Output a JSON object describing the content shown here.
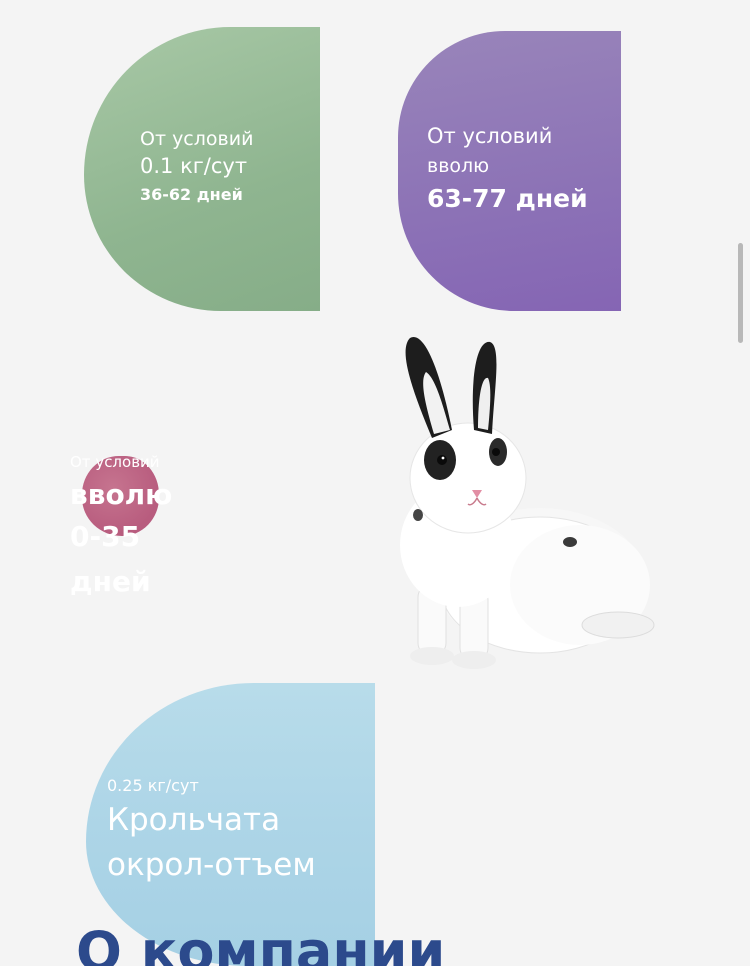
{
  "cards": [
    {
      "lines": [
        "От условий",
        "0.1 кг/сут",
        "36-62 дней"
      ],
      "color": "#9dbf9c"
    },
    {
      "lines": [
        "От условий",
        "вволю",
        "63-77 дней"
      ],
      "color": "#8f78b8"
    },
    {
      "lines": [
        "От условий",
        "вволю",
        "0-35",
        "дней"
      ],
      "color": "#bb6584"
    },
    {
      "lines": [
        "0.25 кг/сут",
        "Крольчата окрол-отъем"
      ],
      "title_lines": [
        "Крольчата",
        "окрол-отъем"
      ],
      "color": "#afd7e8"
    }
  ],
  "about": {
    "heading": "О компании"
  },
  "icons": {
    "rabbit": "rabbit-image"
  }
}
